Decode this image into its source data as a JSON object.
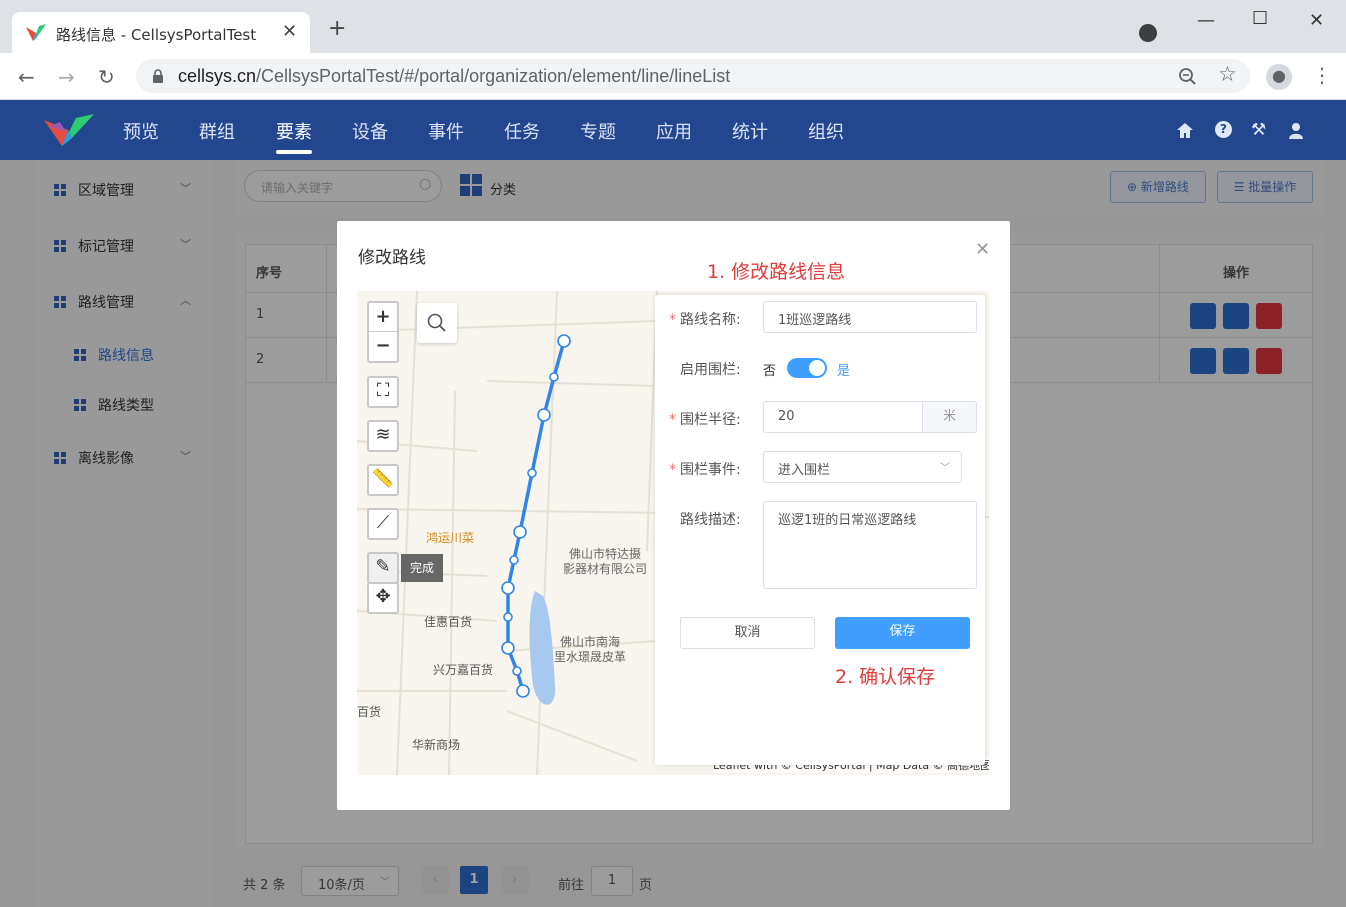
{
  "browser": {
    "tab_title": "路线信息 - CellsysPortalTest",
    "url_host": "cellsys.cn",
    "url_path": "/CellsysPortalTest/#/portal/organization/element/line/lineList"
  },
  "nav": {
    "menu": [
      "预览",
      "群组",
      "要素",
      "设备",
      "事件",
      "任务",
      "专题",
      "应用",
      "统计",
      "组织"
    ],
    "active_index": 2
  },
  "sidebar": {
    "items": [
      {
        "label": "区域管理",
        "expanded": false
      },
      {
        "label": "标记管理",
        "expanded": false
      },
      {
        "label": "路线管理",
        "expanded": true
      },
      {
        "label": "离线影像",
        "expanded": false
      }
    ],
    "subitems": [
      {
        "label": "路线信息",
        "active": true
      },
      {
        "label": "路线类型",
        "active": false
      }
    ]
  },
  "toolbar": {
    "search_placeholder": "请输入关键字",
    "category_label": "分类",
    "add_button": "新增路线",
    "batch_button": "批量操作"
  },
  "table": {
    "col_index": "序号",
    "col_ops": "操作",
    "rows": [
      "1",
      "2"
    ]
  },
  "pagination": {
    "total": "共 2 条",
    "page_size": "10条/页",
    "current": "1",
    "goto_prefix": "前往",
    "goto_value": "1",
    "goto_suffix": "页"
  },
  "modal": {
    "title": "修改路线",
    "note_edit": "1. 修改路线信息",
    "note_save": "2. 确认保存",
    "map": {
      "zoom_in": "+",
      "zoom_out": "−",
      "finish_tooltip": "完成",
      "poi": [
        "鸿运川菜",
        "佛山市特达摄",
        "影器材有限公司",
        "佳惠百货",
        "佛山市南海",
        "里水璟晟皮革",
        "兴万嘉百货",
        "百货",
        "华新商场"
      ],
      "attribution": "Leaflet with © CellsysPortal | Map Data © 高德地图"
    },
    "form": {
      "name_label": "路线名称:",
      "name_value": "1班巡逻路线",
      "fence_label": "启用围栏:",
      "fence_off": "否",
      "fence_on": "是",
      "fence_enabled": true,
      "radius_label": "围栏半径:",
      "radius_value": "20",
      "radius_unit": "米",
      "event_label": "围栏事件:",
      "event_value": "进入围栏",
      "desc_label": "路线描述:",
      "desc_value": "巡逻1班的日常巡逻路线",
      "cancel_button": "取消",
      "save_button": "保存"
    }
  },
  "colors": {
    "header_bg": "#23478f",
    "primary": "#409eff",
    "danger": "#d9363e",
    "note_red": "#e23b3b",
    "route_blue": "#2f86e6"
  }
}
